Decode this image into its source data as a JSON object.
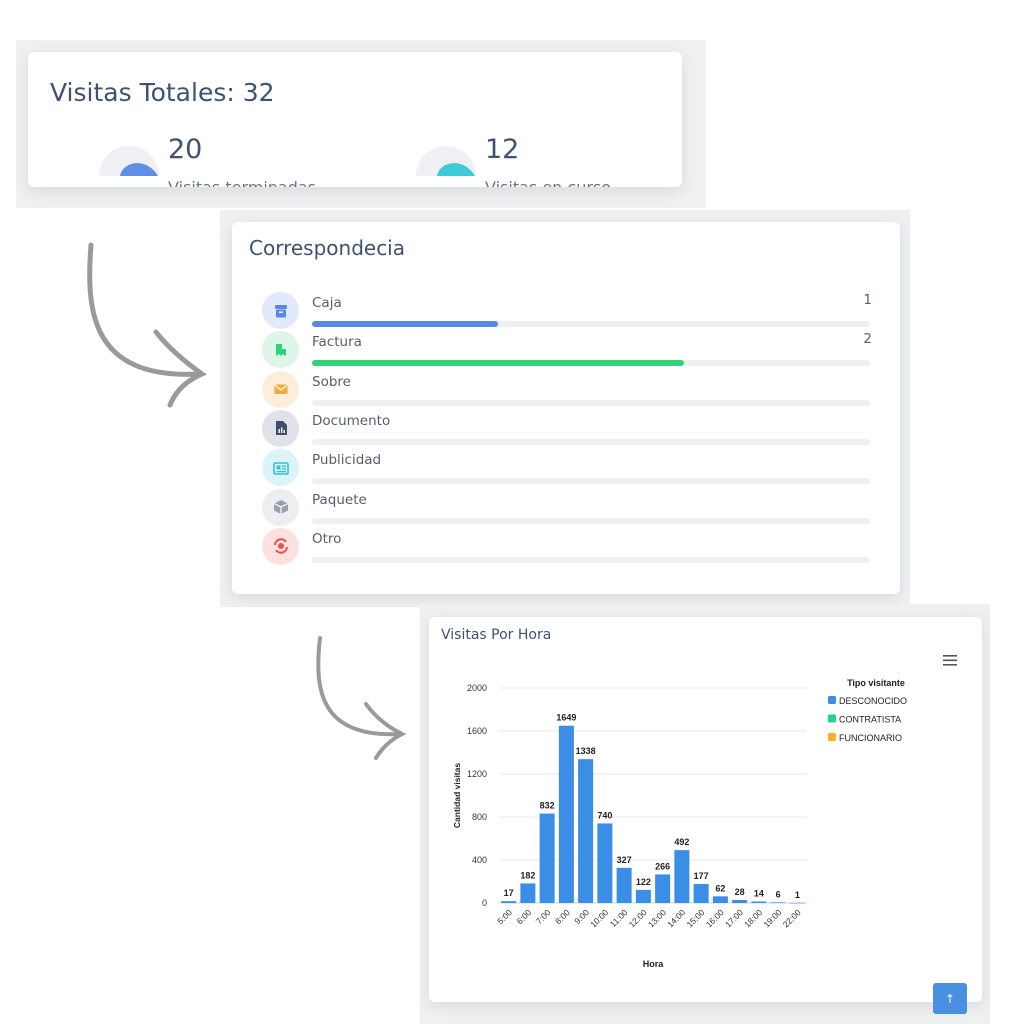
{
  "totals": {
    "title": "Visitas Totales: 32",
    "finished": {
      "value": "20",
      "label": "Visitas terminadas",
      "color": "#5f8ee8"
    },
    "in_progress": {
      "value": "12",
      "label": "Visitas en curso",
      "color": "#3ec9d6"
    }
  },
  "correspondence": {
    "title": "Correspondecia",
    "items": [
      {
        "label": "Caja",
        "count": "1",
        "progress": 0.333,
        "icon": "archive-icon",
        "color": "#5b86e5",
        "bg": "#e1e9fb"
      },
      {
        "label": "Factura",
        "count": "2",
        "progress": 0.667,
        "icon": "receipt-icon",
        "color": "#2fd37a",
        "bg": "#ddf6e8"
      },
      {
        "label": "Sobre",
        "count": "",
        "progress": 0,
        "icon": "envelope-icon",
        "color": "#f7a83a",
        "bg": "#fdeedb"
      },
      {
        "label": "Documento",
        "count": "",
        "progress": 0,
        "icon": "document-chart-icon",
        "color": "#3e4f6e",
        "bg": "#dfe2e8"
      },
      {
        "label": "Publicidad",
        "count": "",
        "progress": 0,
        "icon": "newspaper-icon",
        "color": "#2bc3d3",
        "bg": "#dcf4f7"
      },
      {
        "label": "Paquete",
        "count": "",
        "progress": 0,
        "icon": "package-icon",
        "color": "#9aa1ab",
        "bg": "#eceef1"
      },
      {
        "label": "Otro",
        "count": "",
        "progress": 0,
        "icon": "other-icon",
        "color": "#e8504a",
        "bg": "#fde1e0"
      }
    ]
  },
  "hourly": {
    "title": "Visitas Por Hora",
    "scroll_top_label": "↑"
  },
  "chart_data": {
    "type": "bar",
    "categories": [
      "5:00",
      "6:00",
      "7:00",
      "8:00",
      "9:00",
      "10:00",
      "11:00",
      "12:00",
      "13:00",
      "14:00",
      "15:00",
      "16:00",
      "17:00",
      "18:00",
      "19:00",
      "22:00"
    ],
    "series": [
      {
        "name": "DESCONOCIDO",
        "values": [
          17,
          182,
          832,
          1649,
          1338,
          740,
          327,
          122,
          266,
          492,
          177,
          62,
          28,
          14,
          6,
          1
        ],
        "color": "#3a8ee6"
      }
    ],
    "legend_title": "Tipo visitante",
    "legend": [
      {
        "name": "DESCONOCIDO",
        "color": "#3a8ee6"
      },
      {
        "name": "CONTRATISTA",
        "color": "#22d38d"
      },
      {
        "name": "FUNCIONARIO",
        "color": "#f8b224"
      }
    ],
    "xlabel": "Hora",
    "ylabel": "Cantidad visitas",
    "ylim": [
      0,
      2000
    ],
    "yticks": [
      0,
      400,
      800,
      1200,
      1600,
      2000
    ],
    "grid": true,
    "legend_position": "right"
  }
}
